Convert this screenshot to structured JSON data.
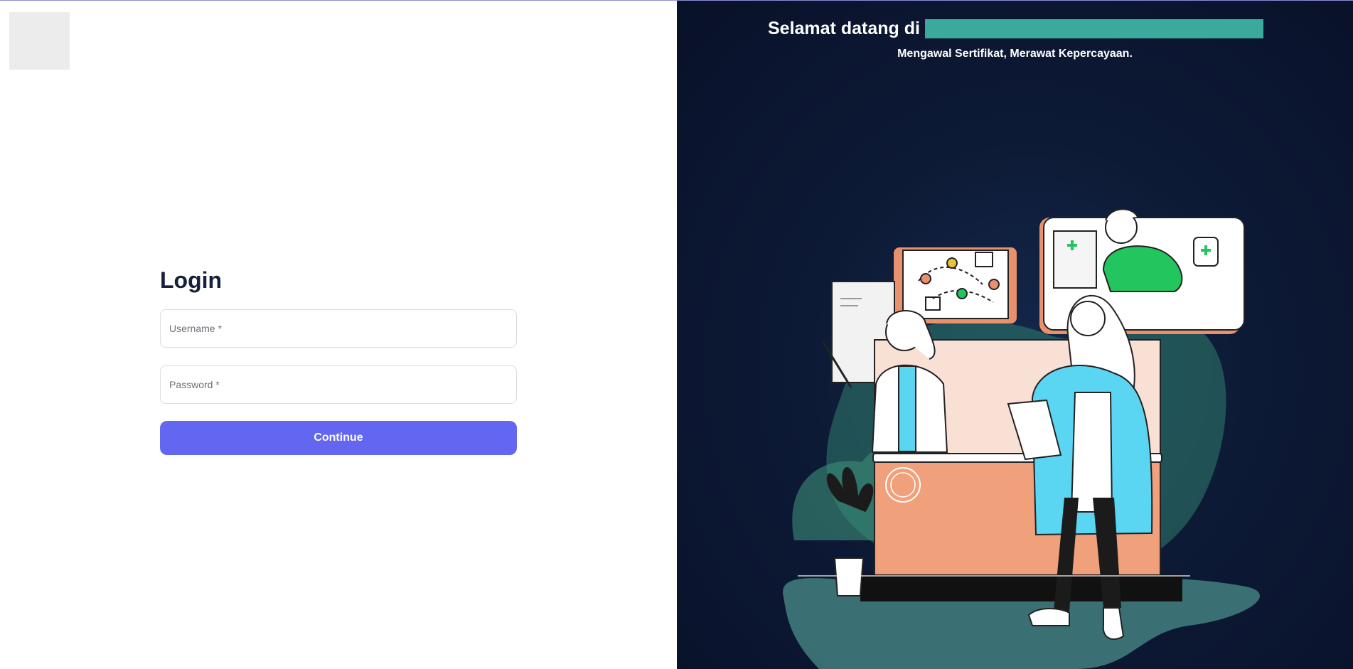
{
  "login": {
    "title": "Login",
    "username_placeholder": "Username *",
    "password_placeholder": "Password *",
    "continue_label": "Continue"
  },
  "hero": {
    "welcome": "Selamat datang di",
    "tagline": "Mengawal Sertifikat, Merawat Kepercayaan."
  },
  "colors": {
    "accent": "#6366f1",
    "panel_bg": "#0d1a35",
    "teal": "#3ba99b"
  }
}
